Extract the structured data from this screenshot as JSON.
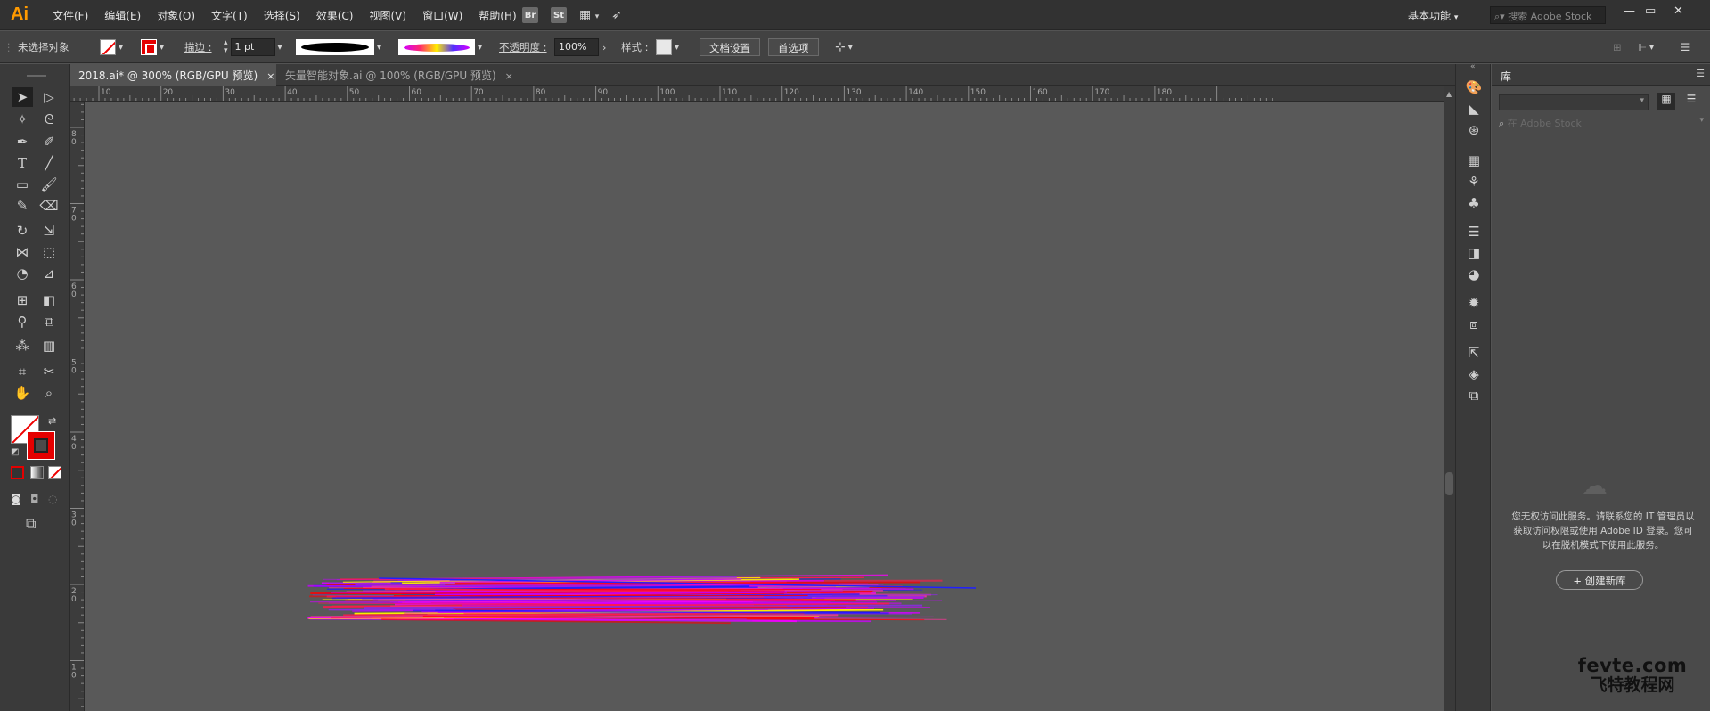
{
  "app": {
    "logo": "Ai"
  },
  "menu": [
    "文件(F)",
    "编辑(E)",
    "对象(O)",
    "文字(T)",
    "选择(S)",
    "效果(C)",
    "视图(V)",
    "窗口(W)",
    "帮助(H)"
  ],
  "menubar_icons": [
    {
      "label": "Br",
      "icon": "bridge-icon"
    },
    {
      "label": "St",
      "icon": "stock-icon"
    }
  ],
  "workspace": {
    "label": "基本功能"
  },
  "search": {
    "text": "搜索 Adobe Stock"
  },
  "window_controls": {
    "minimize": "—",
    "restore": "▭",
    "close": "✕"
  },
  "control_bar": {
    "selection_status": "未选择对象",
    "stroke_label": "描边 :",
    "stroke_weight": "1 pt",
    "opacity_label": "不透明度 :",
    "opacity_value": "100%",
    "style_label": "样式 :",
    "doc_setup": "文档设置",
    "preferences": "首选项"
  },
  "tabs": [
    {
      "label": "2018.ai* @ 300% (RGB/GPU 预览)",
      "active": true,
      "close": "×"
    },
    {
      "label": "矢量智能对象.ai @ 100% (RGB/GPU 预览)",
      "active": false,
      "close": "×"
    }
  ],
  "ruler": {
    "top": [
      "10",
      "20",
      "30",
      "40",
      "50",
      "60",
      "70",
      "80",
      "90",
      "100",
      "110",
      "120",
      "130",
      "140",
      "150",
      "160",
      "170",
      "180"
    ],
    "left": [
      "8\n0",
      "7\n0",
      "6\n0",
      "5\n0",
      "4\n0",
      "3\n0",
      "2\n0",
      "1\n0"
    ]
  },
  "library": {
    "title": "库",
    "search_placeholder": "在 Adobe Stock",
    "message": "您无权访问此服务。请联系您的 IT 管理员以获取访问权限或使用 Adobe ID 登录。您可以在脱机模式下使用此服务。",
    "create_button": "+ 创建新库"
  },
  "watermark": {
    "line1": "fevte.com",
    "line2": "飞特教程网"
  },
  "colors": {
    "accent": "#ff9a00",
    "fill_none_slash": "#e00000",
    "stroke_red": "#e40000",
    "canvas": "#595959"
  }
}
